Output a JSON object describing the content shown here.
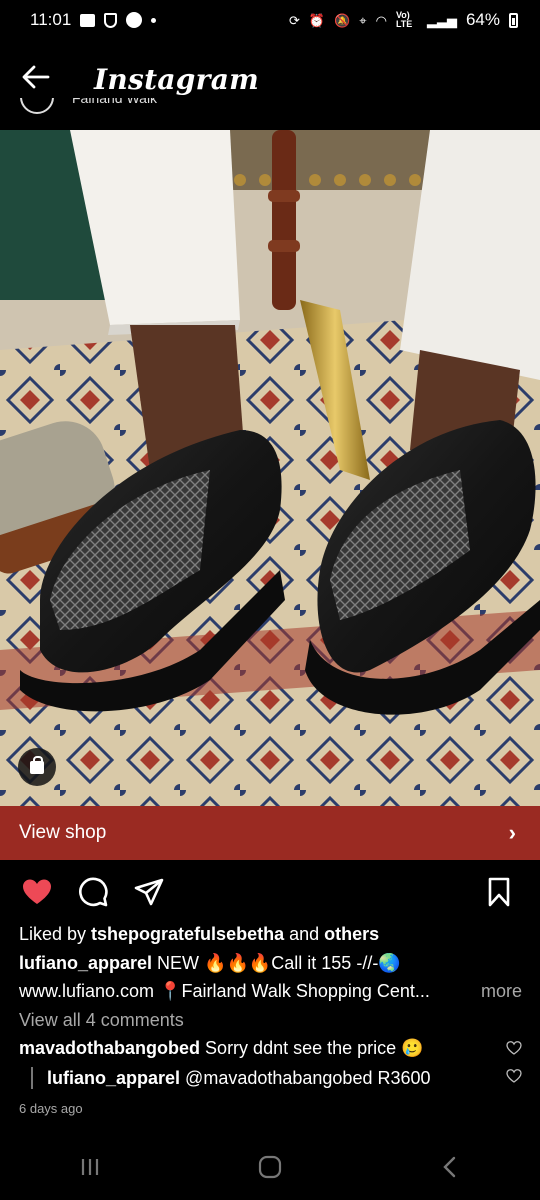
{
  "status_bar": {
    "time": "11:01",
    "battery": "64%",
    "network": "Vo) LTE"
  },
  "header": {
    "title": "Instagram",
    "back_icon": "arrow-left-icon",
    "previous_post_text": "Fairland Walk"
  },
  "post": {
    "image_icon": "shopping-bag-icon",
    "view_shop_label": "View shop",
    "colors": {
      "view_shop_bg": "#9a2a22",
      "like_active": "#ed4956"
    }
  },
  "actions": {
    "like_icon": "heart-filled-icon",
    "comment_icon": "comment-icon",
    "share_icon": "send-icon",
    "save_icon": "bookmark-icon"
  },
  "likes": {
    "prefix": "Liked by ",
    "user": "tshepogratefulsebetha",
    "connector": " and ",
    "suffix": "others"
  },
  "caption": {
    "username": "lufiano_apparel",
    "text_line1": "NEW 🔥🔥🔥Call it 155 -//-🌏",
    "text_line2": "www.lufiano.com 📍Fairland Walk Shopping Cent...",
    "more": "more"
  },
  "view_comments": "View all 4 comments",
  "comments": [
    {
      "username": "mavadothabangobed",
      "text": "Sorry ddnt see the price 🥲"
    }
  ],
  "reply": {
    "username": "lufiano_apparel",
    "text": "@mavadothabangobed R3600"
  },
  "timestamp": "6 days ago"
}
